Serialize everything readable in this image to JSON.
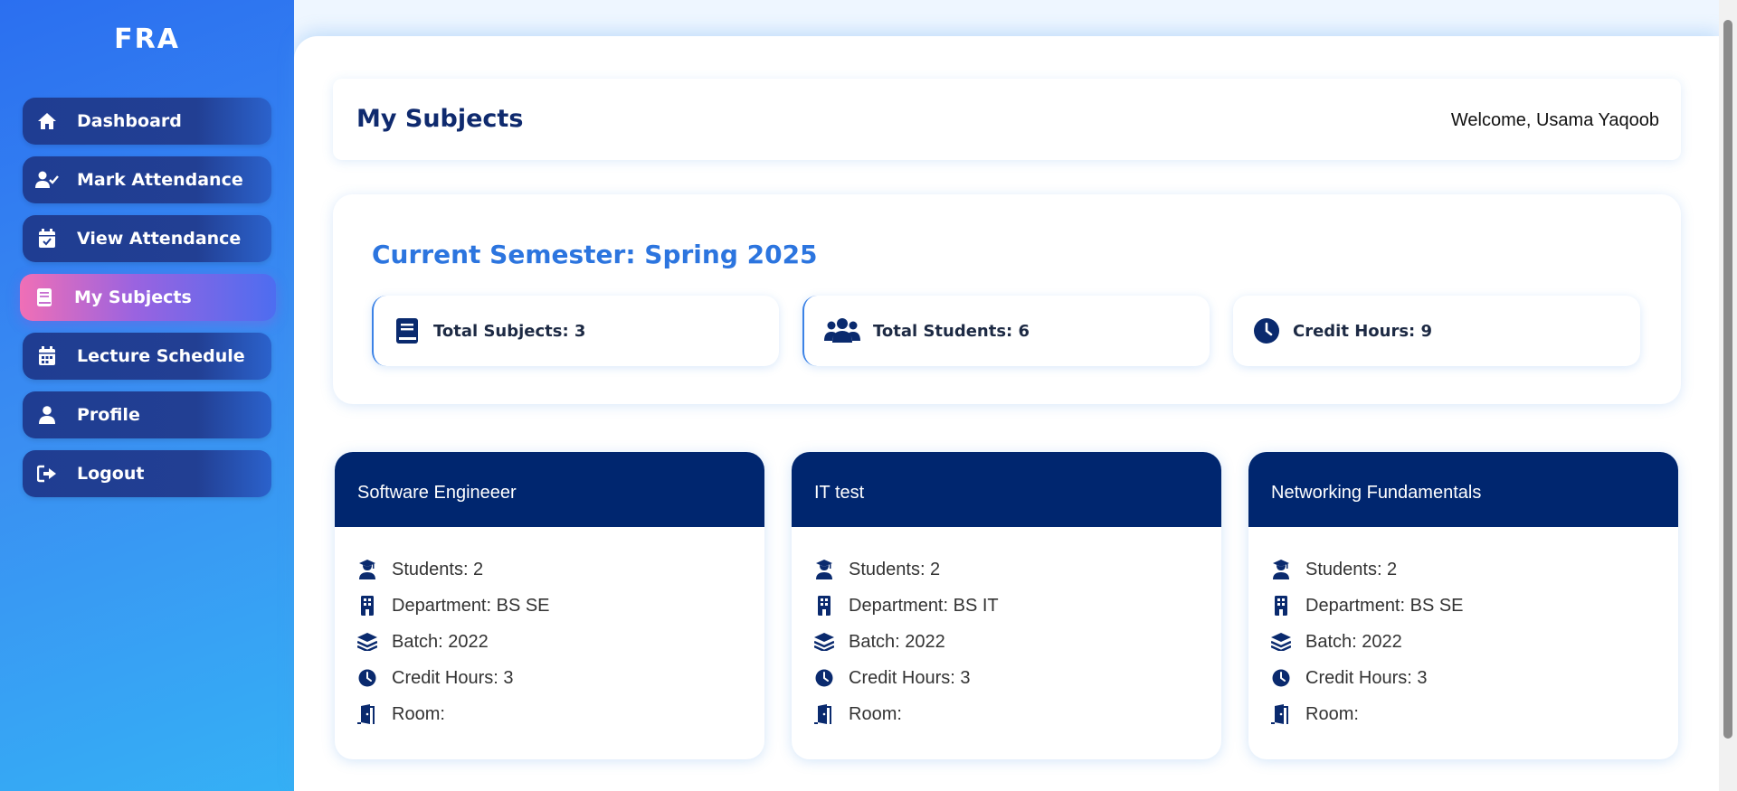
{
  "sidebar": {
    "brand": "FRA",
    "items": [
      {
        "label": "Dashboard",
        "icon": "home-icon"
      },
      {
        "label": "Mark Attendance",
        "icon": "user-check-icon"
      },
      {
        "label": "View Attendance",
        "icon": "calendar-check-icon"
      },
      {
        "label": "My Subjects",
        "icon": "book-icon",
        "active": true
      },
      {
        "label": "Lecture Schedule",
        "icon": "calendar-icon"
      },
      {
        "label": "Profile",
        "icon": "user-icon"
      },
      {
        "label": "Logout",
        "icon": "logout-icon"
      }
    ]
  },
  "header": {
    "title": "My Subjects",
    "welcome": "Welcome, Usama Yaqoob"
  },
  "semester": {
    "title": "Current Semester: Spring 2025",
    "stats": [
      {
        "label": "Total Subjects: 3",
        "icon": "book-icon"
      },
      {
        "label": "Total Students: 6",
        "icon": "users-icon"
      },
      {
        "label": "Credit Hours: 9",
        "icon": "clock-icon"
      }
    ]
  },
  "subjects": [
    {
      "name": "Software Engineeer",
      "students": "Students: 2",
      "department": "Department: BS SE",
      "batch": "Batch: 2022",
      "credit_hours": "Credit Hours: 3",
      "room": "Room:"
    },
    {
      "name": "IT test",
      "students": "Students: 2",
      "department": "Department: BS IT",
      "batch": "Batch: 2022",
      "credit_hours": "Credit Hours: 3",
      "room": "Room:"
    },
    {
      "name": "Networking Fundamentals",
      "students": "Students: 2",
      "department": "Department: BS SE",
      "batch": "Batch: 2022",
      "credit_hours": "Credit Hours: 3",
      "room": "Room:"
    }
  ],
  "colors": {
    "navy": "#00266f",
    "accent": "#2c75df",
    "active_gradient_start": "#f06fb6"
  }
}
